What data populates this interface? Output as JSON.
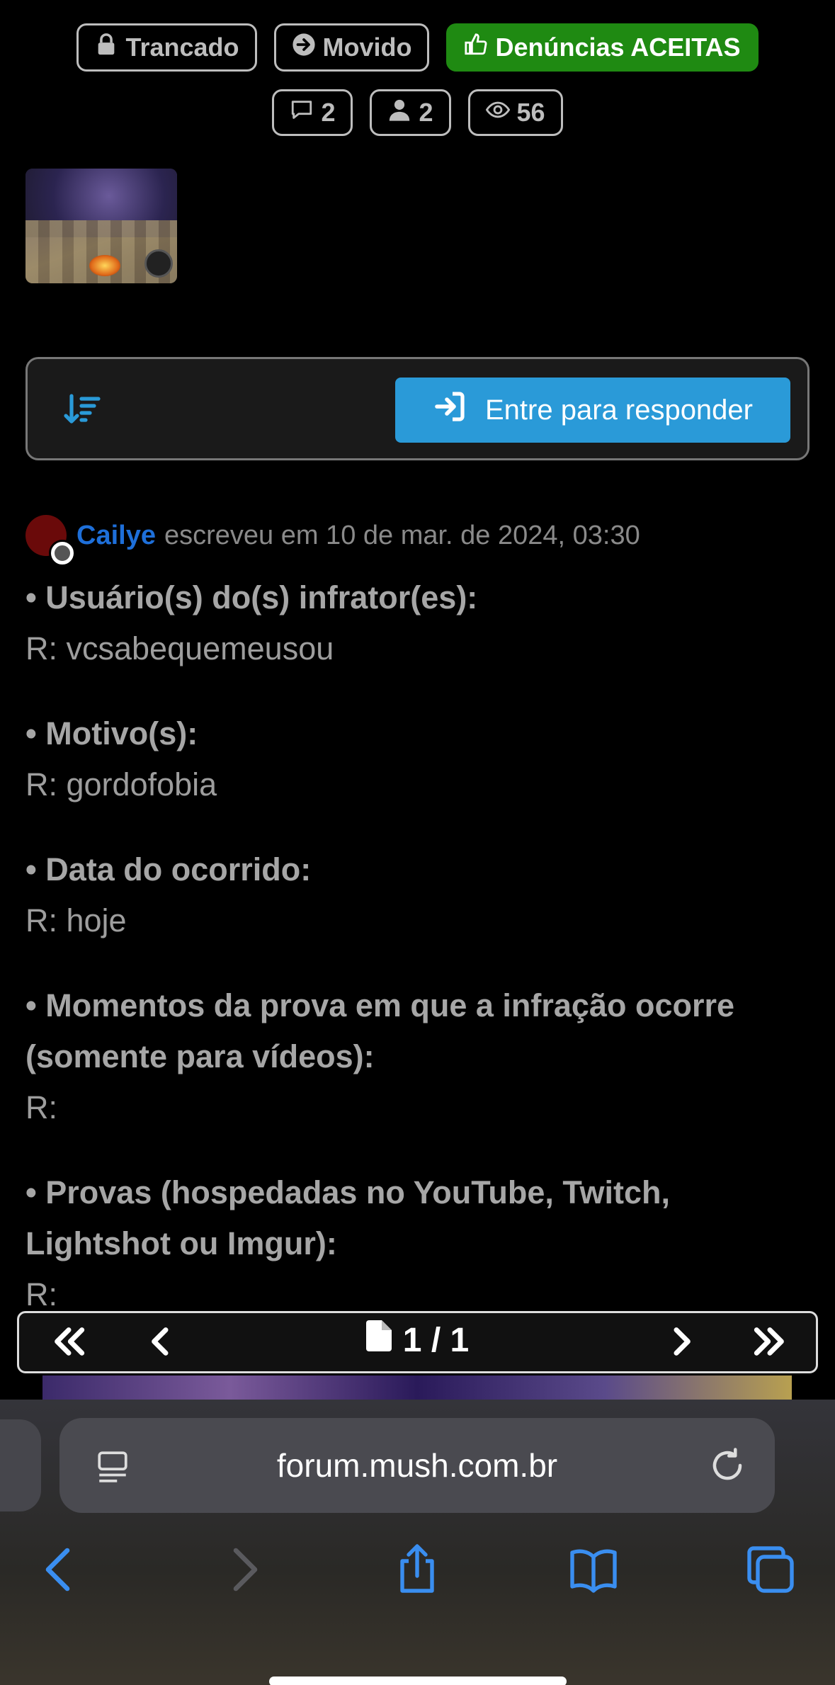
{
  "badges": {
    "locked": "Trancado",
    "moved": "Movido",
    "status": "Denúncias ACEITAS",
    "replies": "2",
    "participants": "2",
    "views": "56"
  },
  "actions": {
    "reply_label": "Entre para responder"
  },
  "post": {
    "author": "Cailye",
    "meta": "escreveu em 10 de mar. de 2024, 03:30",
    "fields": [
      {
        "question": "• Usuário(s) do(s) infrator(es):",
        "answer": "R: vcsabequemeusou"
      },
      {
        "question": "• Motivo(s):",
        "answer": "R: gordofobia"
      },
      {
        "question": "• Data do ocorrido:",
        "answer": "R: hoje"
      },
      {
        "question": "• Momentos da prova em que a infração ocorre (somente para vídeos):",
        "answer": "R:"
      },
      {
        "question": "• Provas (hospedadas no YouTube, Twitch, Lightshot ou Imgur):",
        "answer": "R:"
      }
    ]
  },
  "pagination": {
    "indicator": "1 / 1"
  },
  "browser": {
    "url": "forum.mush.com.br"
  },
  "colors": {
    "accent_blue": "#2a9ad8",
    "status_green": "#1f8a12",
    "author_blue": "#1e6fd9",
    "safari_blue": "#3a8ef0"
  }
}
